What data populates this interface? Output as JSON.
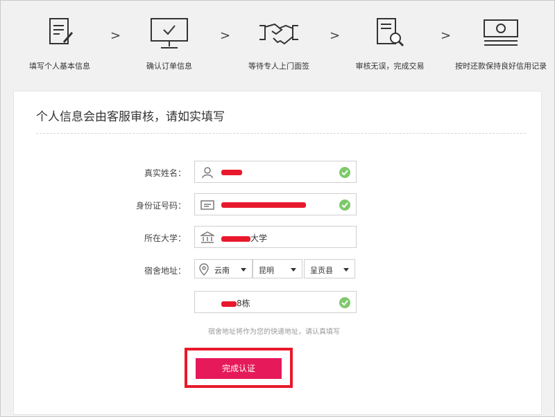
{
  "steps": [
    {
      "label": "填写个人基本信息",
      "icon": "document-pen-icon"
    },
    {
      "label": "确认订单信息",
      "icon": "monitor-check-icon"
    },
    {
      "label": "等待专人上门面签",
      "icon": "handshake-icon"
    },
    {
      "label": "审核无误，完成交易",
      "icon": "document-search-icon"
    },
    {
      "label": "按时还款保持良好信用记录",
      "icon": "banknote-icon"
    }
  ],
  "step_arrow": ">",
  "form": {
    "title": "个人信息会由客服审核，请如实填写",
    "name_label": "真实姓名：",
    "id_label": "身份证号码：",
    "university_label": "所在大学：",
    "university_suffix": "大学",
    "dorm_label": "宿舍地址：",
    "province": "云南",
    "city": "昆明",
    "county": "呈贡县",
    "building_suffix": "8栋",
    "hint": "宿舍地址将作为您的快递地址，请认真填写",
    "submit_label": "完成认证"
  },
  "colors": {
    "accent": "#e6195a",
    "highlight_border": "#e8192c",
    "check": "#7dc96a"
  }
}
